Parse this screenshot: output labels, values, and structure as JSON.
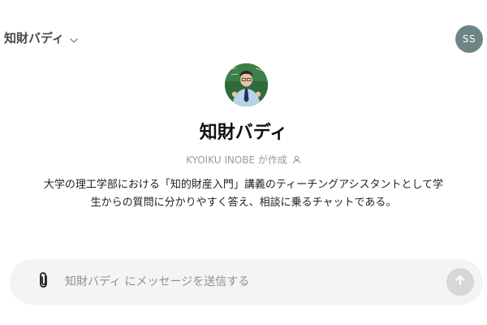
{
  "header": {
    "model_name": "知財バディ",
    "avatar_initials": "SS",
    "chevron_icon": "chevron-down-icon"
  },
  "gpt": {
    "image_icon": "gpt-profile-image",
    "name": "知財バディ",
    "creator": "KYOIKU INOBE が作成",
    "creator_icon": "person-icon",
    "description_line1": "大学の理工学部における「知的財産入門」講義のティーチングアシスタントとして学",
    "description_line2": "生からの質問に分かりやすく答え、相談に乗るチャットである。"
  },
  "composer": {
    "placeholder": "知財バディ にメッセージを送信する",
    "value": "",
    "attach_icon": "paperclip-icon",
    "send_icon": "arrow-up-icon"
  },
  "colors": {
    "avatar_bg": "#6e8585",
    "composer_bg": "#f4f4f4",
    "send_bg": "#d7d7d7",
    "muted_text": "#9a9a9a"
  }
}
